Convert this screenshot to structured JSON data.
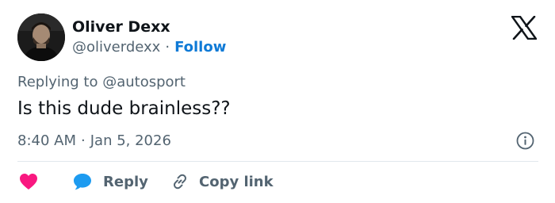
{
  "author": {
    "display_name": "Oliver Dexx",
    "handle": "@oliverdexx",
    "follow_label": "Follow",
    "separator": "·"
  },
  "tweet": {
    "replying_to": "Replying to @autosport",
    "text": "Is this dude brainless??",
    "time": "8:40 AM",
    "date": "Jan 5, 2026"
  },
  "actions": {
    "reply_label": "Reply",
    "copy_link_label": "Copy link"
  },
  "icons": {
    "logo": "x-logo-icon",
    "info": "info-icon",
    "like": "heart-icon",
    "reply": "speech-bubble-icon",
    "copy": "link-icon"
  },
  "colors": {
    "follow": "#0f7ad6",
    "heart": "#f91880",
    "reply_bubble": "#1d9bf0",
    "muted_text": "#536471",
    "primary_text": "#0f1419"
  }
}
